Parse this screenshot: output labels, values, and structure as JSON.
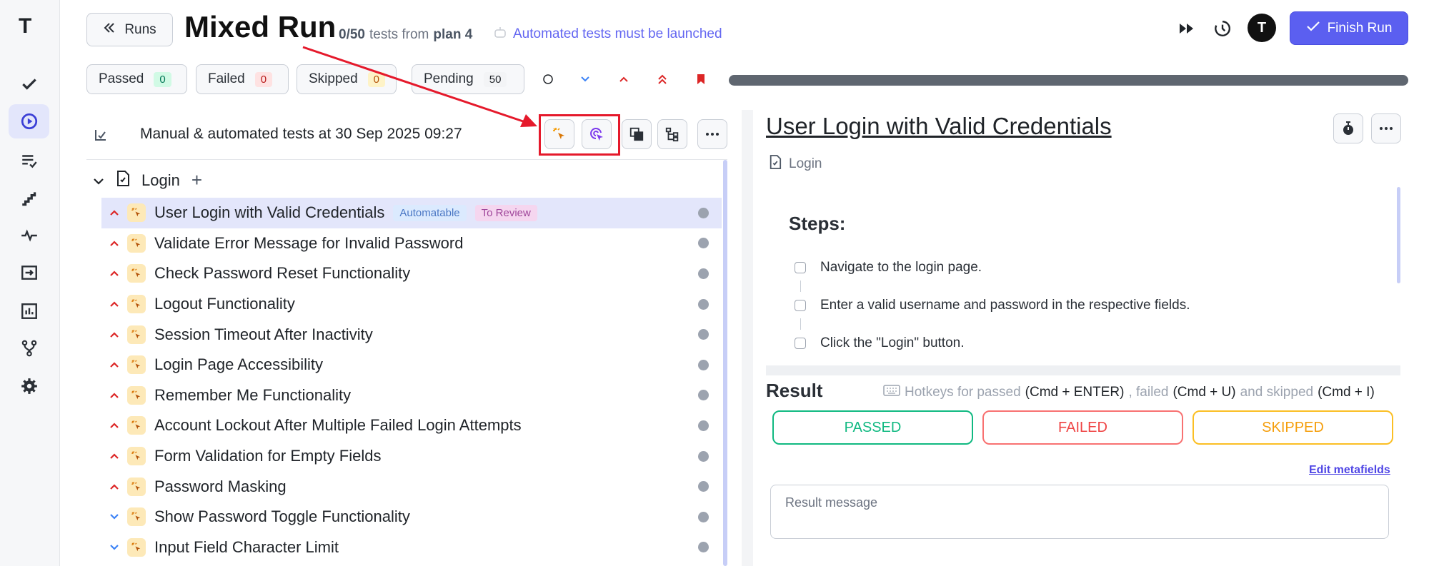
{
  "app": {
    "logo_text": "T"
  },
  "nav": [
    {
      "name": "check-icon"
    },
    {
      "name": "play-circle-icon"
    },
    {
      "name": "list-check-icon"
    },
    {
      "name": "stairs-icon"
    },
    {
      "name": "pulse-icon"
    },
    {
      "name": "import-icon"
    },
    {
      "name": "bar-chart-icon"
    },
    {
      "name": "fork-icon"
    },
    {
      "name": "gear-icon"
    }
  ],
  "header": {
    "runs_label": "Runs",
    "title": "Mixed Run",
    "progress_count": "0/50",
    "progress_text": "tests from",
    "plan": "plan 4",
    "automated_note": "Automated tests must be launched",
    "avatar_text": "T",
    "finish_label": "Finish Run"
  },
  "filters": [
    {
      "label": "Passed",
      "count": "0",
      "bg": "#d1fae5",
      "fg": "#047857"
    },
    {
      "label": "Failed",
      "count": "0",
      "bg": "#fee2e2",
      "fg": "#b91c1c"
    },
    {
      "label": "Skipped",
      "count": "0",
      "bg": "#fef3c7",
      "fg": "#b45309"
    },
    {
      "label": "Pending",
      "count": "50",
      "bg": "#f3f4f6",
      "fg": "#1f2328"
    }
  ],
  "panel": {
    "title": "Manual & automated tests at 30 Sep 2025 09:27",
    "suite": "Login"
  },
  "tests": [
    {
      "label": "User Login with Valid Credentials",
      "priority": "up",
      "tags": [
        "Automatable",
        "To Review"
      ]
    },
    {
      "label": "Validate Error Message for Invalid Password",
      "priority": "up"
    },
    {
      "label": "Check Password Reset Functionality",
      "priority": "up"
    },
    {
      "label": "Logout Functionality",
      "priority": "up"
    },
    {
      "label": "Session Timeout After Inactivity",
      "priority": "up"
    },
    {
      "label": "Login Page Accessibility",
      "priority": "up"
    },
    {
      "label": "Remember Me Functionality",
      "priority": "up"
    },
    {
      "label": "Account Lockout After Multiple Failed Login Attempts",
      "priority": "up"
    },
    {
      "label": "Form Validation for Empty Fields",
      "priority": "up"
    },
    {
      "label": "Password Masking",
      "priority": "up"
    },
    {
      "label": "Show Password Toggle Functionality",
      "priority": "down"
    },
    {
      "label": "Input Field Character Limit",
      "priority": "down"
    }
  ],
  "case": {
    "title": "User Login with Valid Credentials",
    "breadcrumb": "Login",
    "steps_title": "Steps:",
    "steps": [
      "Navigate to the login page.",
      "Enter a valid username and password in the respective fields.",
      "Click the \"Login\" button."
    ],
    "result_title": "Result",
    "hotkeys": {
      "p1": "Hotkeys for passed",
      "k1": "(Cmd + ENTER)",
      "p2": ", failed",
      "k2": "(Cmd + U)",
      "p3": "and skipped",
      "k3": "(Cmd + I)"
    },
    "passed": "PASSED",
    "failed": "FAILED",
    "skipped": "SKIPPED",
    "edit_metafields": "Edit metafields",
    "result_placeholder": "Result message"
  },
  "colors": {
    "accent": "#5b5ff0",
    "priority_up": "#dc2626",
    "priority_down": "#3b82f6",
    "annotation": "#e5192b"
  }
}
